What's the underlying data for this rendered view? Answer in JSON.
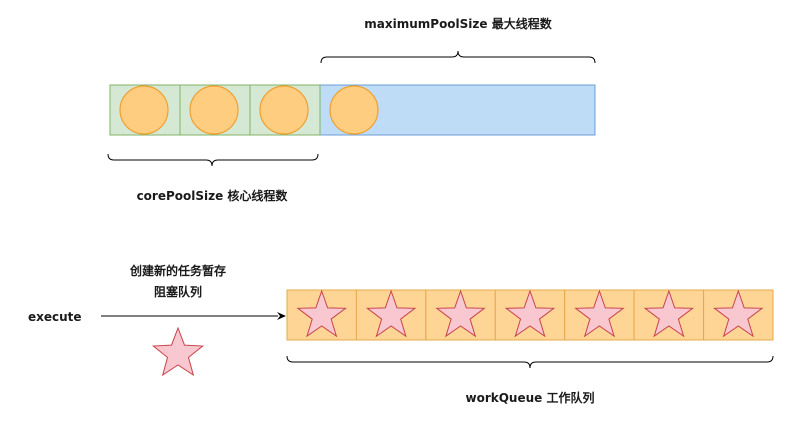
{
  "labels": {
    "max_pool": "maximumPoolSize 最大线程数",
    "core_pool": "corePoolSize 核心线程数",
    "queue_line1": "创建新的任务暂存",
    "queue_line2": "阻塞队列",
    "execute": "execute",
    "work_queue": "workQueue 工作队列"
  },
  "pool": {
    "core_thread_count": 3,
    "extra_thread_count": 1
  },
  "queue": {
    "task_count": 7
  },
  "colors": {
    "core_fill": "#d5e8d4",
    "core_stroke": "#82b366",
    "max_fill": "#bfdcf7",
    "max_stroke": "#6c9ed4",
    "thread_fill": "#ffcd80",
    "thread_stroke": "#f0a030",
    "queue_fill": "#ffd596",
    "queue_stroke": "#e6a94b",
    "star_fill": "#f8c7cf",
    "star_stroke": "#c8434a"
  }
}
